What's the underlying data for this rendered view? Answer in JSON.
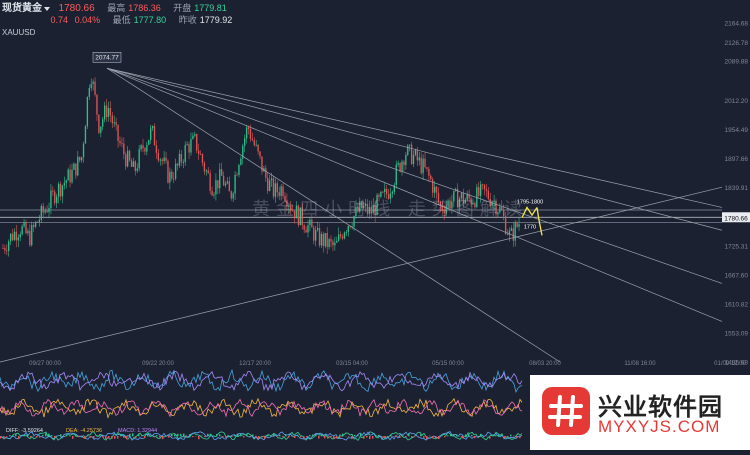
{
  "header": {
    "symbol_name": "现货黄金",
    "symbol_code": "XAUUSD",
    "last_price": "1780.66",
    "change": "0.74",
    "change_pct": "0.04%",
    "high_label": "最高",
    "high_value": "1786.36",
    "open_label": "开盘",
    "open_value": "1779.81",
    "low_label": "最低",
    "low_value": "1777.80",
    "prev_close_label": "昨收",
    "prev_close_value": "1779.92"
  },
  "watermark": {
    "overlay_text": "黄金四小时线 走势图解读",
    "site_title": "兴业软件园",
    "site_url": "MYXYJS.COM"
  },
  "indicators": {
    "dif_label": "DIFF: -3.59264",
    "dea_label": "DEA: -4.25736",
    "macd_label": "MACD: 1.32944"
  },
  "chart_data": {
    "type": "candlestick",
    "x_ticks": [
      "09/27 00:00",
      "09/22 20:00",
      "12/17 20:00",
      "03/15 04:00",
      "05/15 00:00",
      "08/03 20:00",
      "11/08 16:00",
      "01/09 12:00"
    ],
    "y_ticks": [
      2164.68,
      2126.78,
      2089.88,
      2012.2,
      1954.49,
      1897.66,
      1839.91,
      1780.66,
      1725.31,
      1667.6,
      1610.82,
      1553.09,
      1495.68
    ],
    "ylim": [
      1495,
      2170
    ],
    "last_price": 1780.66,
    "annotations": [
      {
        "text": "2074.77",
        "kind": "high-label"
      },
      {
        "text": "1795-1800",
        "kind": "target-zone"
      },
      {
        "text": "1770",
        "kind": "support"
      }
    ],
    "approx_close_path": [
      1720,
      1745,
      1760,
      1740,
      1775,
      1800,
      1830,
      1850,
      1870,
      1900,
      2074,
      1960,
      2000,
      1940,
      1900,
      1870,
      1920,
      1950,
      1900,
      1860,
      1880,
      1920,
      1930,
      1880,
      1840,
      1860,
      1820,
      1900,
      1960,
      1910,
      1860,
      1830,
      1840,
      1800,
      1780,
      1760,
      1740,
      1730,
      1720,
      1760,
      1780,
      1800,
      1790,
      1810,
      1830,
      1870,
      1910,
      1900,
      1880,
      1850,
      1800,
      1810,
      1820,
      1815,
      1820,
      1830,
      1815,
      1790,
      1740,
      1770
    ]
  }
}
